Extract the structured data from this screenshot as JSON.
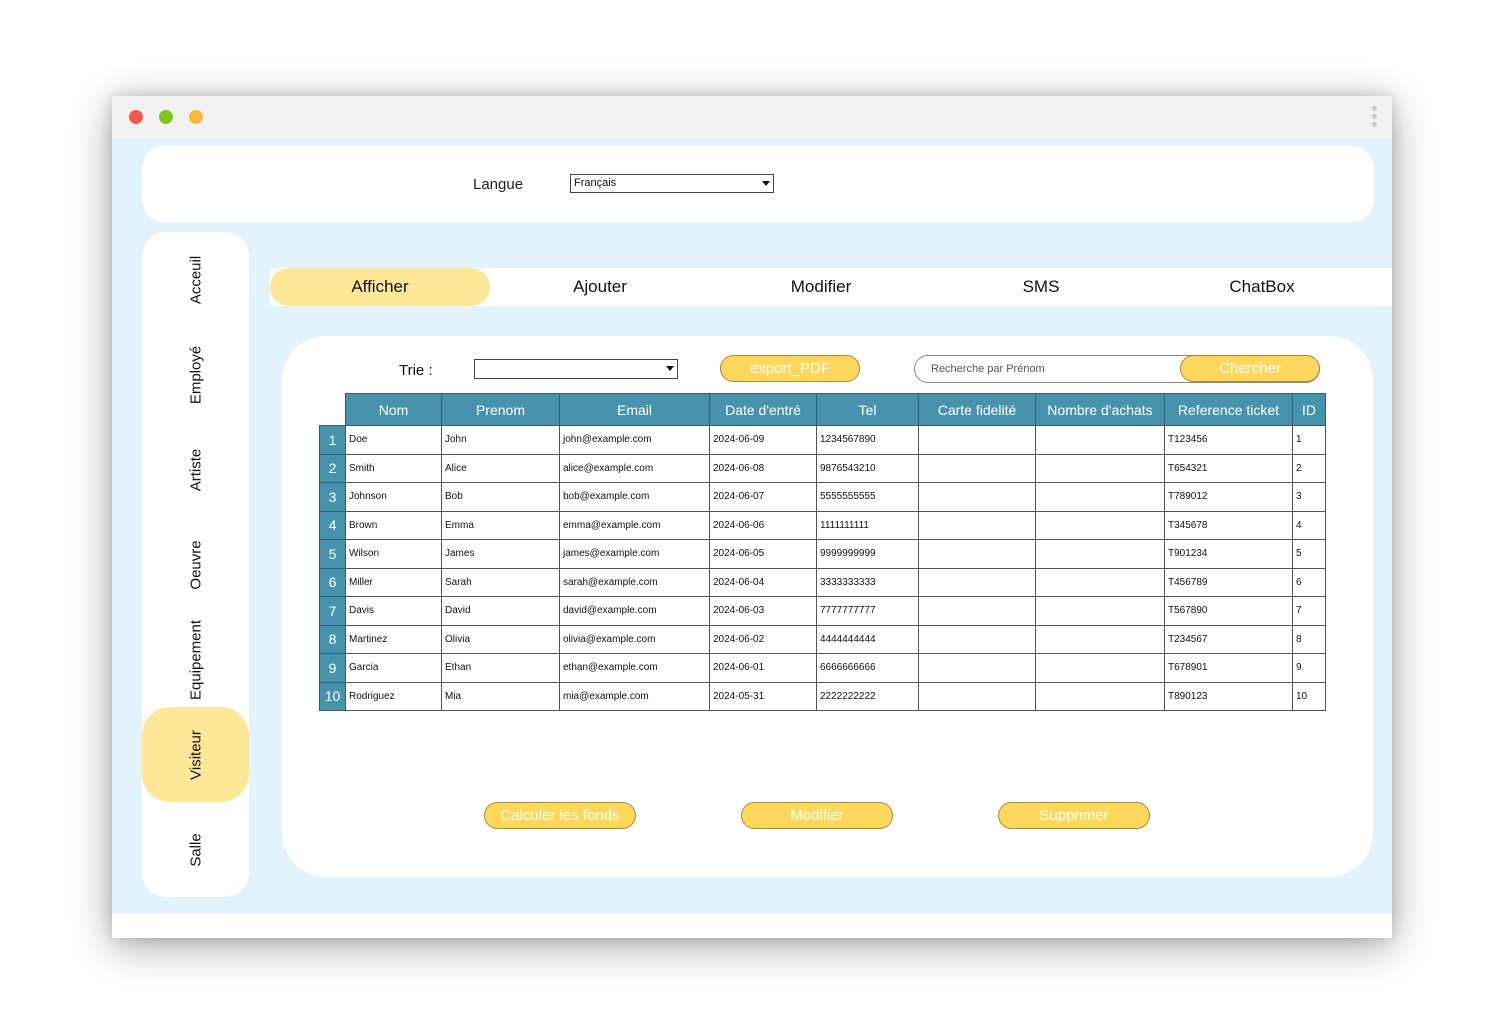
{
  "language": {
    "label": "Langue",
    "value": "Français"
  },
  "sidebar": {
    "items": [
      {
        "label": "Acceuil"
      },
      {
        "label": "Employé"
      },
      {
        "label": "Artiste"
      },
      {
        "label": "Oeuvre"
      },
      {
        "label": "Equipement"
      },
      {
        "label": "Visiteur",
        "active": true
      },
      {
        "label": "Salle"
      }
    ]
  },
  "tabs": [
    {
      "label": "Afficher",
      "active": true
    },
    {
      "label": "Ajouter"
    },
    {
      "label": "Modifier"
    },
    {
      "label": "SMS"
    },
    {
      "label": "ChatBox"
    }
  ],
  "toolbar": {
    "sort_label": "Trie :",
    "sort_value": "",
    "export_label": "export_PDF",
    "search_placeholder": "Recherche par Prénom",
    "search_button": "Chercher"
  },
  "table": {
    "columns": [
      "Nom",
      "Prenom",
      "Email",
      "Date d'entré",
      "Tel",
      "Carte fidelité",
      "Nombre d'achats",
      "Reference ticket",
      "ID"
    ],
    "rows": [
      {
        "num": "1",
        "cells": [
          "Doe",
          "John",
          "john@example.com",
          "2024-06-09",
          "1234567890",
          "",
          "",
          "T123456",
          "1"
        ]
      },
      {
        "num": "2",
        "cells": [
          "Smith",
          "Alice",
          "alice@example.com",
          "2024-06-08",
          "9876543210",
          "",
          "",
          "T654321",
          "2"
        ]
      },
      {
        "num": "3",
        "cells": [
          "Johnson",
          "Bob",
          "bob@example.com",
          "2024-06-07",
          "5555555555",
          "",
          "",
          "T789012",
          "3"
        ]
      },
      {
        "num": "4",
        "cells": [
          "Brown",
          "Emma",
          "emma@example.com",
          "2024-06-06",
          "1111111111",
          "",
          "",
          "T345678",
          "4"
        ]
      },
      {
        "num": "5",
        "cells": [
          "Wilson",
          "James",
          "james@example.com",
          "2024-06-05",
          "9999999999",
          "",
          "",
          "T901234",
          "5"
        ]
      },
      {
        "num": "6",
        "cells": [
          "Miller",
          "Sarah",
          "sarah@example.com",
          "2024-06-04",
          "3333333333",
          "",
          "",
          "T456789",
          "6"
        ]
      },
      {
        "num": "7",
        "cells": [
          "Davis",
          "David",
          "david@example.com",
          "2024-06-03",
          "7777777777",
          "",
          "",
          "T567890",
          "7"
        ]
      },
      {
        "num": "8",
        "cells": [
          "Martinez",
          "Olivia",
          "olivia@example.com",
          "2024-06-02",
          "4444444444",
          "",
          "",
          "T234567",
          "8"
        ]
      },
      {
        "num": "9",
        "cells": [
          "Garcia",
          "Ethan",
          "ethan@example.com",
          "2024-06-01",
          "6666666666",
          "",
          "",
          "T678901",
          "9"
        ]
      },
      {
        "num": "10",
        "cells": [
          "Rodriguez",
          "Mia",
          "mia@example.com",
          "2024-05-31",
          "2222222222",
          "",
          "",
          "T890123",
          "10"
        ]
      }
    ]
  },
  "actions": {
    "calculate_label": "Calculer les fonds",
    "edit_label": "Modifier",
    "delete_label": "Supprimer"
  },
  "colors": {
    "background": "#e2f3fc",
    "accent_yellow": "#fdd85a",
    "active_highlight": "#fde89a",
    "table_header": "#4793ad"
  }
}
